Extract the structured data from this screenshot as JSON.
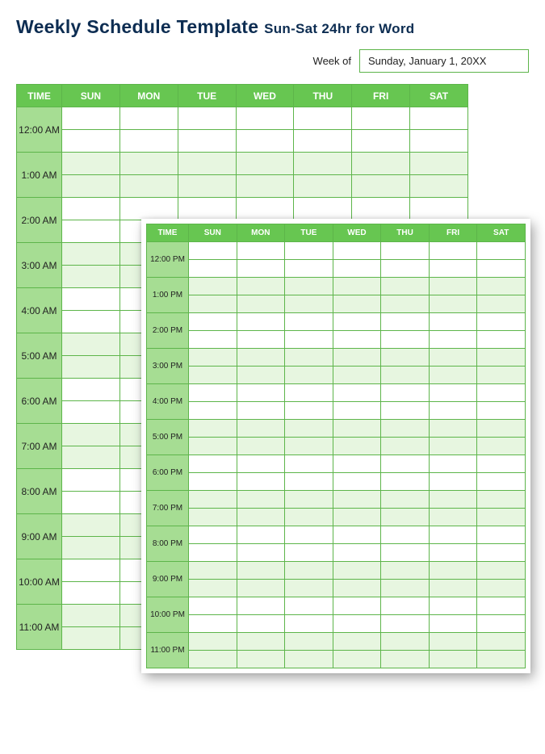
{
  "title_main": "Weekly Schedule Template",
  "title_sub": "Sun-Sat 24hr for Word",
  "weekof_label": "Week of",
  "weekof_value": "Sunday, January 1, 20XX",
  "columns": {
    "time": "TIME",
    "days": [
      "SUN",
      "MON",
      "TUE",
      "WED",
      "THU",
      "FRI",
      "SAT"
    ]
  },
  "times_am": [
    "12:00 AM",
    "1:00 AM",
    "2:00 AM",
    "3:00 AM",
    "4:00 AM",
    "5:00 AM",
    "6:00 AM",
    "7:00 AM",
    "8:00 AM",
    "9:00 AM",
    "10:00 AM",
    "11:00 AM"
  ],
  "times_pm": [
    "12:00 PM",
    "1:00 PM",
    "2:00 PM",
    "3:00 PM",
    "4:00 PM",
    "5:00 PM",
    "6:00 PM",
    "7:00 PM",
    "8:00 PM",
    "9:00 PM",
    "10:00 PM",
    "11:00 PM"
  ]
}
